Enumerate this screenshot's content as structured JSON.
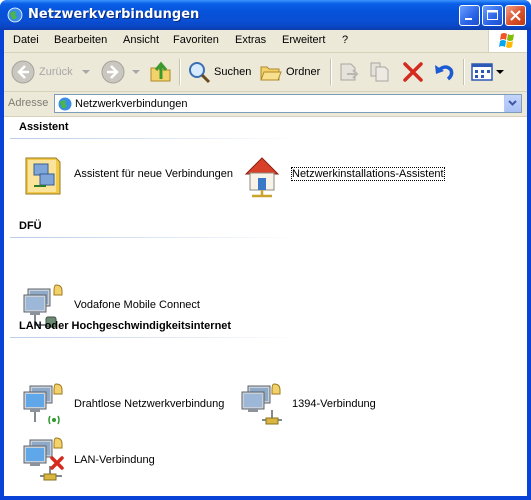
{
  "window": {
    "title": "Netzwerkverbindungen"
  },
  "menu": [
    "Datei",
    "Bearbeiten",
    "Ansicht",
    "Favoriten",
    "Extras",
    "Erweitert",
    "?"
  ],
  "toolbar": {
    "back_label": "Zurück",
    "search_label": "Suchen",
    "folders_label": "Ordner"
  },
  "address": {
    "label": "Adresse",
    "value": "Netzwerkverbindungen"
  },
  "groups": [
    {
      "title": "Assistent",
      "items": [
        {
          "label": "Assistent für neue Verbindungen",
          "icon": "new-connection-wizard-icon"
        },
        {
          "label": "Netzwerkinstallations-Assistent",
          "icon": "home-network-wizard-icon"
        }
      ]
    },
    {
      "title": "DFÜ",
      "items": [
        {
          "label": "Vodafone Mobile Connect",
          "icon": "dialup-connection-icon"
        }
      ]
    },
    {
      "title": "LAN oder Hochgeschwindigkeitsinternet",
      "items": [
        {
          "label": "Drahtlose Netzwerkverbindung",
          "icon": "wireless-connection-icon"
        },
        {
          "label": "1394-Verbindung",
          "icon": "network-connection-icon"
        },
        {
          "label": "LAN-Verbindung",
          "icon": "lan-disconnected-icon"
        }
      ]
    }
  ],
  "colors": {
    "titlebar": "#0a5fe8",
    "frame": "#ece9d8"
  }
}
